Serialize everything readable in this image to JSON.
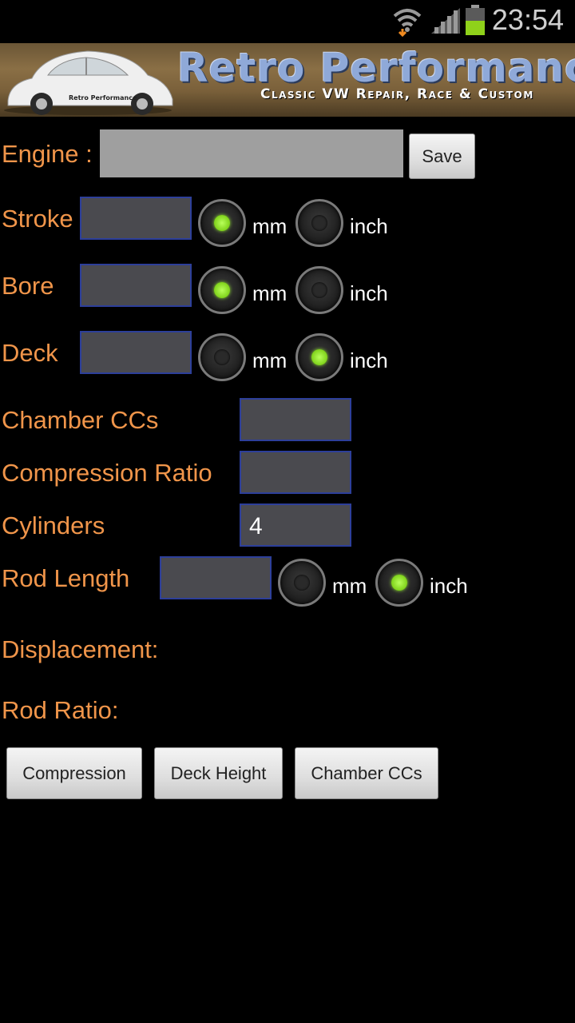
{
  "status_bar": {
    "time": "23:54",
    "icons": [
      "wifi-icon",
      "signal-icon",
      "battery-icon"
    ]
  },
  "banner": {
    "title": "Retro Performance",
    "subtitle": "Classic VW Repair, Race & Custom",
    "car_decal": "Retro Performance"
  },
  "engine": {
    "label": "Engine :",
    "value": "",
    "save_label": "Save"
  },
  "stroke": {
    "label": "Stroke",
    "value": "",
    "unit_mm": "mm",
    "unit_inch": "inch",
    "selected": "mm"
  },
  "bore": {
    "label": "Bore",
    "value": "",
    "unit_mm": "mm",
    "unit_inch": "inch",
    "selected": "mm"
  },
  "deck": {
    "label": "Deck",
    "value": "",
    "unit_mm": "mm",
    "unit_inch": "inch",
    "selected": "inch"
  },
  "chamber": {
    "label": "Chamber CCs",
    "value": ""
  },
  "compression": {
    "label": "Compression Ratio",
    "value": ""
  },
  "cylinders": {
    "label": "Cylinders",
    "value": "4"
  },
  "rod_length": {
    "label": "Rod Length",
    "value": "",
    "unit_mm": "mm",
    "unit_inch": "inch",
    "selected": "inch"
  },
  "results": {
    "displacement_label": "Displacement:",
    "rod_ratio_label": "Rod Ratio:"
  },
  "actions": {
    "compression_label": "Compression",
    "deck_height_label": "Deck Height",
    "chamber_label": "Chamber CCs"
  },
  "colors": {
    "label": "#f0954a",
    "field_bg": "#4a4a4f",
    "field_border": "#2d3f9a",
    "radio_on": "#7fd21a"
  }
}
